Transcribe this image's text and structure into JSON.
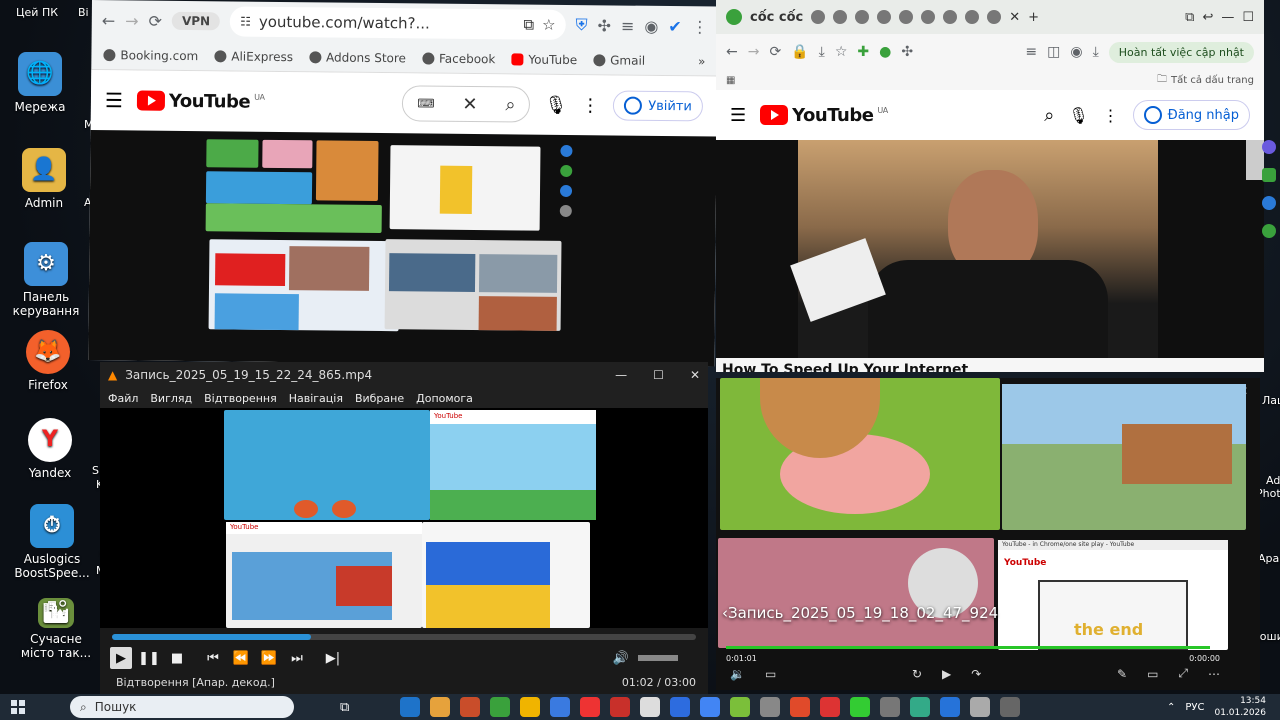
{
  "desktop": {
    "icons": [
      {
        "label": "Мережа",
        "color": "#3b8fd6",
        "glyph": "🌐"
      },
      {
        "label": "Admin",
        "color": "#e5b645",
        "glyph": "👤"
      },
      {
        "label": "Панель керування",
        "color": "#3d8fd9",
        "glyph": "⚙"
      },
      {
        "label": "Firefox",
        "color": "#f3602b",
        "glyph": "🦊"
      },
      {
        "label": "Yandex",
        "color": "#ffffff",
        "glyph": "Y"
      },
      {
        "label": "Auslogics BoostSpee...",
        "color": "#2c8fd6",
        "glyph": "⏱"
      },
      {
        "label": "Сучасне місто так...",
        "color": "#6b8f3c",
        "glyph": "🏙"
      }
    ],
    "partials": {
      "this_pc": "Цей ПК",
      "bi": "Bi",
      "m": "M",
      "av": "Av",
      "st": "St",
      "h": "H",
      "sp": "Sp",
      "ki": "Ki",
      "v": "V",
      "mc": "Mc",
      "lash": "Лаш",
      "ado": "Ado",
      "photo": "Photo",
      "apar": "Apar",
      "koshy": "Кошик"
    }
  },
  "chrome_left": {
    "vpn_label": "VPN",
    "url": "youtube.com/watch?...",
    "bookmarks": [
      "Booking.com",
      "AliExpress",
      "Addons Store",
      "Facebook",
      "YouTube",
      "Gmail"
    ],
    "more": "»",
    "yt_logo": "YouTube",
    "yt_region": "UA",
    "signin_label": "Увійти"
  },
  "coccoc": {
    "brand": "cốc cốc",
    "update_label": "Hoàn tất việc cập nhật",
    "all_bookmarks": "Tất cả dấu trang",
    "yt_logo": "YouTube",
    "yt_region": "UA",
    "signin_label": "Đăng nhập",
    "video_title": "How To Speed Up Your Internet"
  },
  "vlc": {
    "title": "Запись_2025_05_19_15_22_24_865.mp4",
    "menu": [
      "Файл",
      "Вигляд",
      "Відтворення",
      "Навігація",
      "Вибране",
      "Допомога"
    ],
    "status_text": "Відтворення [Апар. декод.]",
    "time": "01:02 / 03:00",
    "progress": 0.34,
    "inner_yt_logo": "YouTube"
  },
  "player2": {
    "title": "Запись_2025_05_19_18_02_47_924",
    "time_left": "0:01:01",
    "time_right": "0:00:00",
    "progress": 0.98,
    "inner_yt_logo": "YouTube",
    "inner_tab": "YouTube - in Chrome/one site play - YouTube",
    "end_text": "the end"
  },
  "taskbar": {
    "search_placeholder": "Пошук",
    "lang": "РУС",
    "time": "13:54",
    "date": "01.01.2026",
    "apps": [
      "#1e73c9",
      "#e6a23c",
      "#c94d2a",
      "#3aa13c",
      "#f0b400",
      "#3a7ae0",
      "#e33",
      "#c8302a",
      "#ddd",
      "#2d6cdf",
      "#4285f4",
      "#7bbf3a",
      "#888",
      "#e04a2a",
      "#d33",
      "#3c3",
      "#777",
      "#3a8",
      "#2673d9",
      "#aaa",
      "#666"
    ]
  }
}
